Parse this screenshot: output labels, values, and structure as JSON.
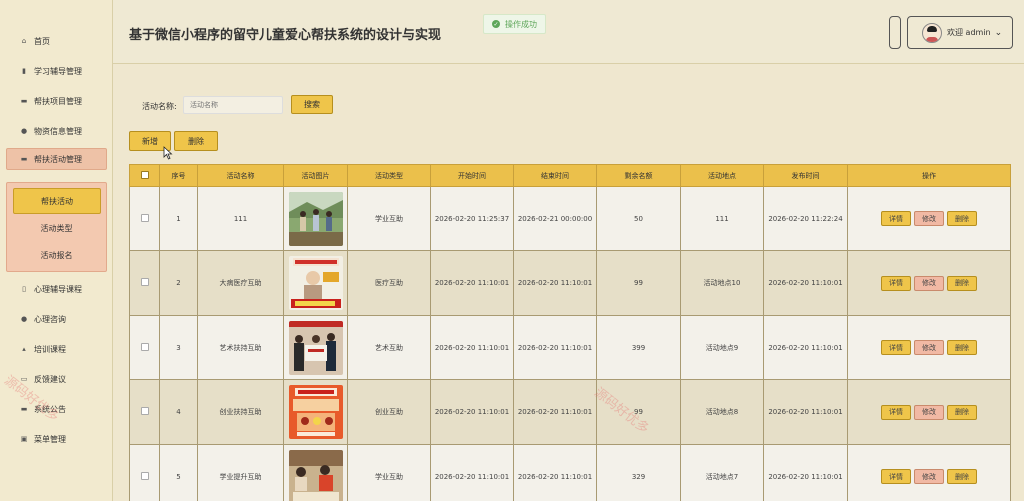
{
  "sidebar": {
    "items": [
      {
        "label": "首页",
        "icon": "home-icon"
      },
      {
        "label": "学习辅导管理",
        "icon": "bar-chart-icon"
      },
      {
        "label": "帮扶项目管理",
        "icon": "folder-icon"
      },
      {
        "label": "物资信息管理",
        "icon": "circle-icon"
      },
      {
        "label": "帮扶活动管理",
        "icon": "calendar-icon"
      },
      {
        "label": "心理辅导课程",
        "icon": "book-icon"
      },
      {
        "label": "心理咨询",
        "icon": "lightbulb-icon"
      },
      {
        "label": "培训课程",
        "icon": "graduation-icon"
      },
      {
        "label": "反馈建议",
        "icon": "message-icon"
      },
      {
        "label": "系统公告",
        "icon": "notice-icon"
      },
      {
        "label": "菜单管理",
        "icon": "menu-icon"
      }
    ],
    "submenu": [
      "帮扶活动",
      "活动类型",
      "活动报名"
    ]
  },
  "header": {
    "title": "基于微信小程序的留守儿童爱心帮扶系统的设计与实现",
    "toast": "操作成功",
    "user_label": "欢迎 admin",
    "dropdown_glyph": "⌄"
  },
  "search": {
    "label": "活动名称:",
    "placeholder": "活动名称",
    "button": "搜索"
  },
  "toolbar": {
    "add": "新增",
    "delete": "删除"
  },
  "table": {
    "columns": [
      "序号",
      "活动名称",
      "活动图片",
      "活动类型",
      "开始时间",
      "结束时间",
      "剩余名额",
      "活动地点",
      "发布时间",
      "操作"
    ],
    "actions": {
      "detail": "详情",
      "edit": "修改",
      "remove": "删除"
    },
    "rows": [
      {
        "no": "1",
        "name": "111",
        "type": "学业互助",
        "start": "2026-02-20 11:25:37",
        "end": "2026-02-21 00:00:00",
        "remain": "50",
        "place": "111",
        "publish": "2026-02-20 11:22:24"
      },
      {
        "no": "2",
        "name": "大病医疗互助",
        "type": "医疗互助",
        "start": "2026-02-20 11:10:01",
        "end": "2026-02-20 11:10:01",
        "remain": "99",
        "place": "活动地点10",
        "publish": "2026-02-20 11:10:01"
      },
      {
        "no": "3",
        "name": "艺术扶持互助",
        "type": "艺术互助",
        "start": "2026-02-20 11:10:01",
        "end": "2026-02-20 11:10:01",
        "remain": "399",
        "place": "活动地点9",
        "publish": "2026-02-20 11:10:01"
      },
      {
        "no": "4",
        "name": "创业扶持互助",
        "type": "创业互助",
        "start": "2026-02-20 11:10:01",
        "end": "2026-02-20 11:10:01",
        "remain": "99",
        "place": "活动地点8",
        "publish": "2026-02-20 11:10:01"
      },
      {
        "no": "5",
        "name": "学业提升互助",
        "type": "学业互助",
        "start": "2026-02-20 11:10:01",
        "end": "2026-02-20 11:10:01",
        "remain": "329",
        "place": "活动地点7",
        "publish": "2026-02-20 11:10:01"
      }
    ]
  },
  "watermarks": [
    "源码好优多",
    "源码好优多"
  ],
  "colors": {
    "accent": "#efc54a",
    "active_menu": "#eec2a7",
    "toast_green": "#5ea65a"
  }
}
